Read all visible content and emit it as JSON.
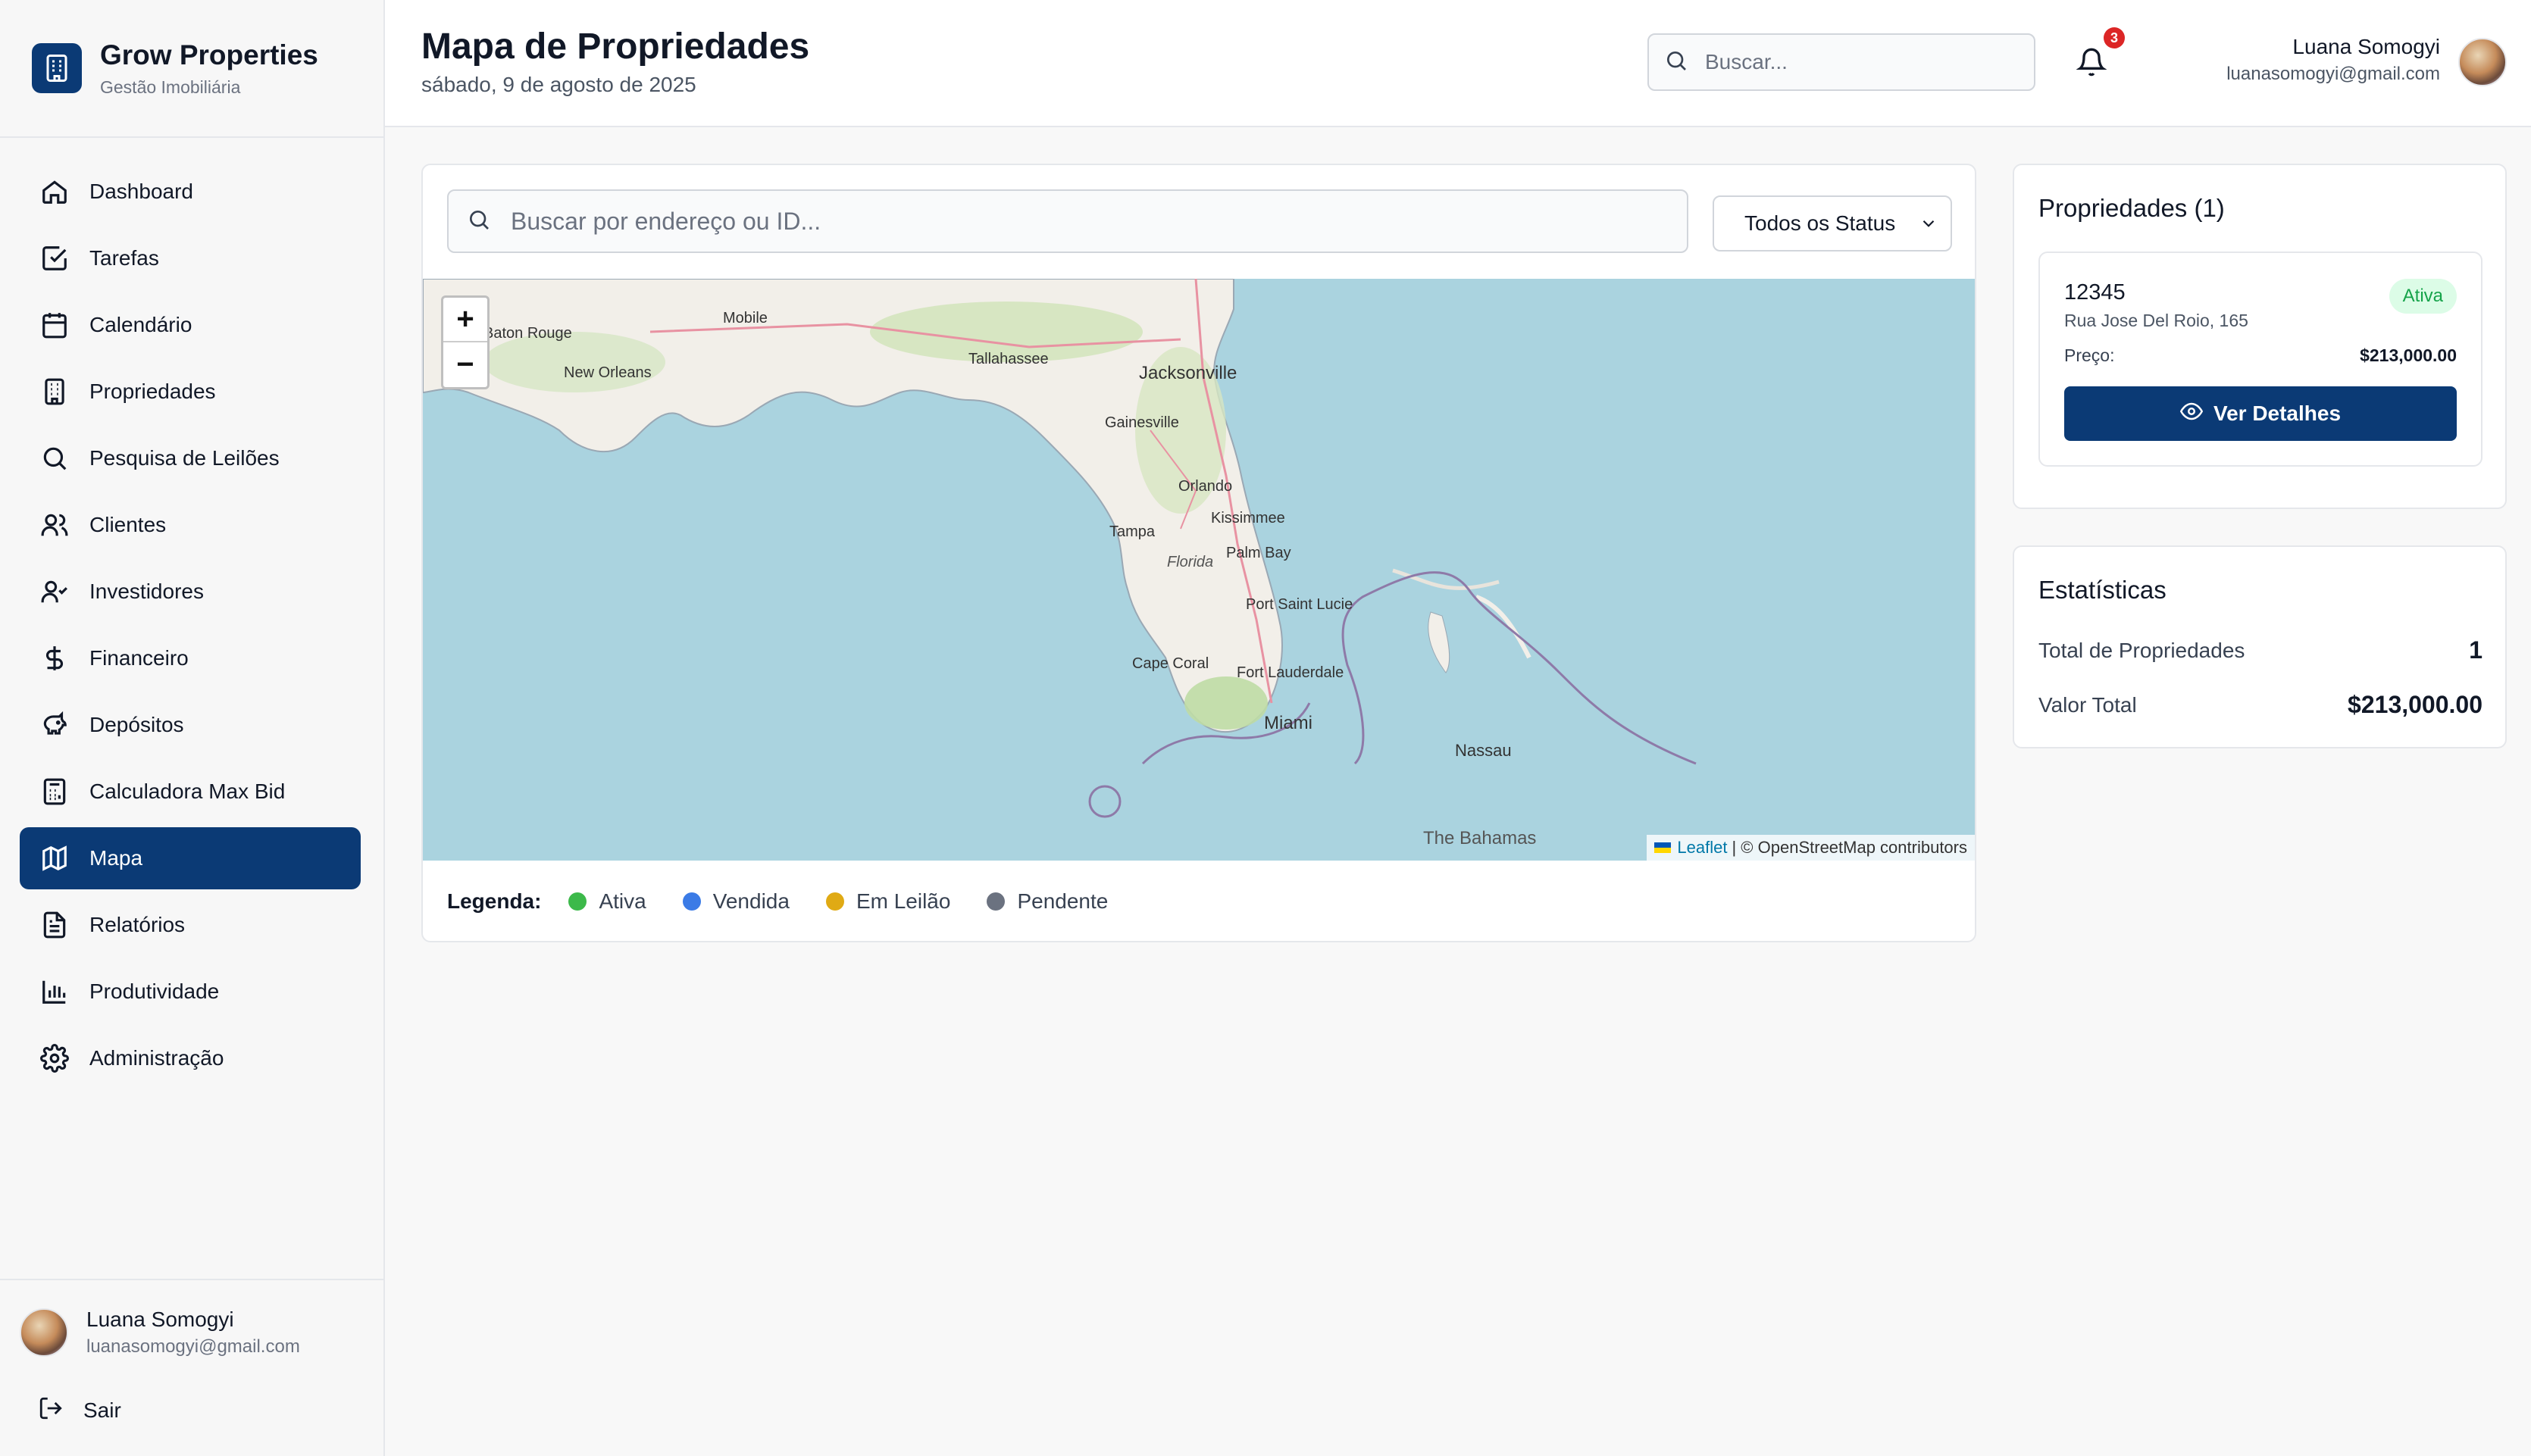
{
  "brand": {
    "title": "Grow Properties",
    "subtitle": "Gestão Imobiliária"
  },
  "sidebar": {
    "items": [
      {
        "label": "Dashboard",
        "icon": "home-icon"
      },
      {
        "label": "Tarefas",
        "icon": "checkbox-icon"
      },
      {
        "label": "Calendário",
        "icon": "calendar-icon"
      },
      {
        "label": "Propriedades",
        "icon": "building-icon"
      },
      {
        "label": "Pesquisa de Leilões",
        "icon": "search-icon"
      },
      {
        "label": "Clientes",
        "icon": "users-icon"
      },
      {
        "label": "Investidores",
        "icon": "user-check-icon"
      },
      {
        "label": "Financeiro",
        "icon": "dollar-icon"
      },
      {
        "label": "Depósitos",
        "icon": "piggy-bank-icon"
      },
      {
        "label": "Calculadora Max Bid",
        "icon": "calculator-icon"
      },
      {
        "label": "Mapa",
        "icon": "map-icon",
        "active": true
      },
      {
        "label": "Relatórios",
        "icon": "file-text-icon"
      },
      {
        "label": "Produtividade",
        "icon": "bar-chart-icon"
      },
      {
        "label": "Administração",
        "icon": "gear-icon"
      }
    ],
    "user": {
      "name": "Luana Somogyi",
      "email": "luanasomogyi@gmail.com"
    },
    "logout_label": "Sair"
  },
  "header": {
    "title": "Mapa de Propriedades",
    "date": "sábado, 9 de agosto de 2025",
    "search_placeholder": "Buscar...",
    "notification_count": "3",
    "user": {
      "name": "Luana Somogyi",
      "email": "luanasomogyi@gmail.com"
    }
  },
  "map_panel": {
    "search_placeholder": "Buscar por endereço ou ID...",
    "status_filter": "Todos os Status",
    "zoom_in": "+",
    "zoom_out": "−",
    "attribution_link": "Leaflet",
    "attribution_text": "| © OpenStreetMap contributors",
    "places": [
      "Baton Rouge",
      "Mobile",
      "Tallahassee",
      "Jacksonville",
      "New Orleans",
      "Gainesville",
      "Orlando",
      "Kissimmee",
      "Tampa",
      "Florida",
      "Palm Bay",
      "Port Saint Lucie",
      "Cape Coral",
      "Fort Lauderdale",
      "Miami",
      "Nassau",
      "The Bahamas"
    ],
    "legend": {
      "title": "Legenda:",
      "items": [
        {
          "label": "Ativa",
          "color": "#3cb94a"
        },
        {
          "label": "Vendida",
          "color": "#3b7be6"
        },
        {
          "label": "Em Leilão",
          "color": "#e0aa14"
        },
        {
          "label": "Pendente",
          "color": "#6b7280"
        }
      ]
    }
  },
  "properties_panel": {
    "title": "Propriedades (1)",
    "items": [
      {
        "id": "12345",
        "address": "Rua Jose Del Roio, 165",
        "status": "Ativa",
        "price_label": "Preço:",
        "price": "$213,000.00",
        "button_label": "Ver Detalhes"
      }
    ]
  },
  "stats_panel": {
    "title": "Estatísticas",
    "total_label": "Total de Propriedades",
    "total_value": "1",
    "value_label": "Valor Total",
    "value_value": "$213,000.00"
  },
  "colors": {
    "primary": "#0b3a75",
    "water": "#aad3df",
    "land": "#f2efe9"
  }
}
